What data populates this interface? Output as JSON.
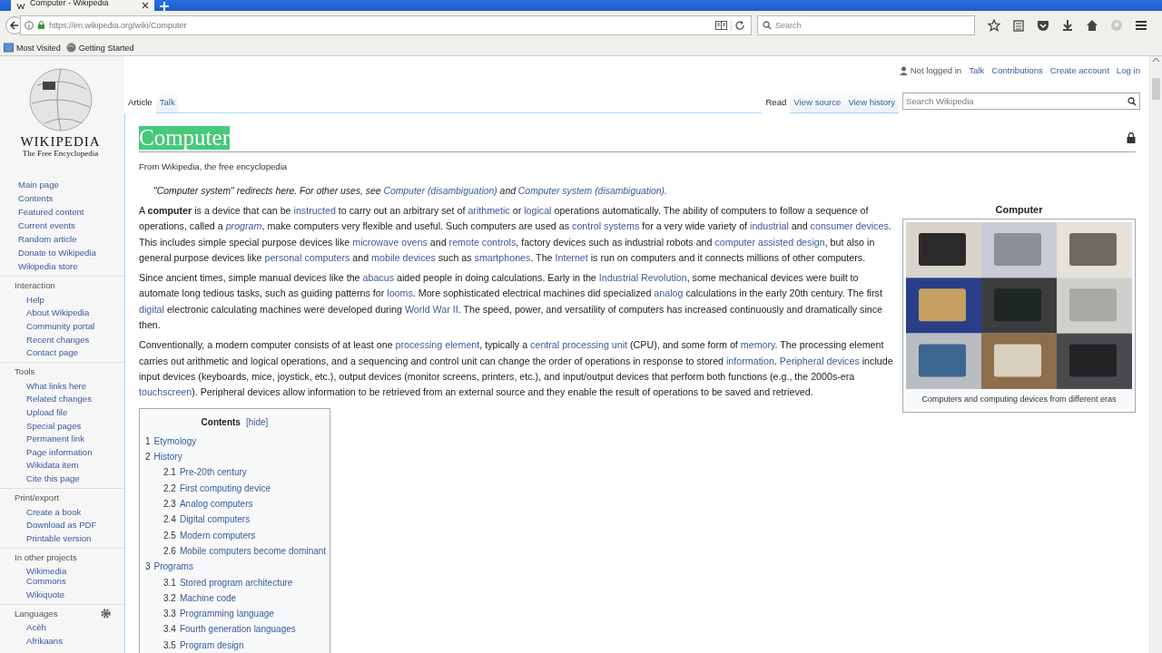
{
  "browser": {
    "tab": {
      "title": "Computer - Wikipedia",
      "selected": true
    },
    "url": "https://en.wikipedia.org/wiki/Computer",
    "search_placeholder": "Search",
    "bookmarks": [
      "Most Visited",
      "Getting Started"
    ]
  },
  "logo": {
    "wordmark": "WIKIPEDIA",
    "tagline": "The Free Encyclopedia"
  },
  "sidebar": {
    "main": [
      "Main page",
      "Contents",
      "Featured content",
      "Current events",
      "Random article",
      "Donate to Wikipedia",
      "Wikipedia store"
    ],
    "sections": [
      {
        "heading": "Interaction",
        "items": [
          "Help",
          "About Wikipedia",
          "Community portal",
          "Recent changes",
          "Contact page"
        ]
      },
      {
        "heading": "Tools",
        "items": [
          "What links here",
          "Related changes",
          "Upload file",
          "Special pages",
          "Permanent link",
          "Page information",
          "Wikidata item",
          "Cite this page"
        ]
      },
      {
        "heading": "Print/export",
        "items": [
          "Create a book",
          "Download as PDF",
          "Printable version"
        ]
      },
      {
        "heading": "In other projects",
        "items": [
          "Wikimedia Commons",
          "Wikiquote"
        ]
      },
      {
        "heading": "Languages",
        "settings": true,
        "items": [
          "Acèh",
          "Afrikaans"
        ]
      }
    ]
  },
  "personal": {
    "status": "Not logged in",
    "links": [
      "Talk",
      "Contributions",
      "Create account",
      "Log in"
    ]
  },
  "left_tabs": [
    {
      "label": "Article",
      "selected": true
    },
    {
      "label": "Talk",
      "selected": false
    }
  ],
  "right_tabs": [
    {
      "label": "Read",
      "selected": true
    },
    {
      "label": "View source",
      "selected": false
    },
    {
      "label": "View history",
      "selected": false
    }
  ],
  "wiki_search": {
    "placeholder": "Search Wikipedia"
  },
  "title": {
    "text": "Computer",
    "highlighted": true
  },
  "tagline": "From Wikipedia, the free encyclopedia",
  "hatnote": [
    {
      "kind": "text",
      "text": "\"Computer system\" redirects here. For other uses, see "
    },
    {
      "kind": "link",
      "text": "Computer (disambiguation)"
    },
    {
      "kind": "text",
      "text": " and "
    },
    {
      "kind": "link",
      "text": "Computer system (disambiguation)"
    },
    {
      "kind": "text",
      "text": "."
    }
  ],
  "paragraphs": [
    [
      {
        "kind": "text",
        "text": "A **computer** is a device that can be "
      },
      {
        "kind": "link",
        "text": "instructed"
      },
      {
        "kind": "text",
        "text": " to carry out an arbitrary set of "
      },
      {
        "kind": "link",
        "text": "arithmetic"
      },
      {
        "kind": "text",
        "text": " or "
      },
      {
        "kind": "link",
        "text": "logical"
      },
      {
        "kind": "text",
        "text": " operations automatically. The ability of computers to follow a sequence of operations, called a "
      },
      {
        "kind": "link",
        "text": "*program*"
      },
      {
        "kind": "text",
        "text": ", make computers very flexible and useful. Such computers are used as "
      },
      {
        "kind": "link",
        "text": "control systems"
      },
      {
        "kind": "text",
        "text": " for a very wide variety of "
      },
      {
        "kind": "link",
        "text": "industrial"
      },
      {
        "kind": "text",
        "text": " and "
      },
      {
        "kind": "link",
        "text": "consumer devices"
      },
      {
        "kind": "text",
        "text": ". This includes simple special purpose devices like "
      },
      {
        "kind": "link",
        "text": "microwave ovens"
      },
      {
        "kind": "text",
        "text": " and "
      },
      {
        "kind": "link",
        "text": "remote controls"
      },
      {
        "kind": "text",
        "text": ", factory devices such as industrial robots and "
      },
      {
        "kind": "link",
        "text": "computer assisted design"
      },
      {
        "kind": "text",
        "text": ", but also in general purpose devices like "
      },
      {
        "kind": "link",
        "text": "personal computers"
      },
      {
        "kind": "text",
        "text": " and "
      },
      {
        "kind": "link",
        "text": "mobile devices"
      },
      {
        "kind": "text",
        "text": " such as "
      },
      {
        "kind": "link",
        "text": "smartphones"
      },
      {
        "kind": "text",
        "text": ". The "
      },
      {
        "kind": "link",
        "text": "Internet"
      },
      {
        "kind": "text",
        "text": " is run on computers and it connects millions of other computers."
      }
    ],
    [
      {
        "kind": "text",
        "text": "Since ancient times, simple manual devices like the "
      },
      {
        "kind": "link",
        "text": "abacus"
      },
      {
        "kind": "text",
        "text": " aided people in doing calculations. Early in the "
      },
      {
        "kind": "link",
        "text": "Industrial Revolution"
      },
      {
        "kind": "text",
        "text": ", some mechanical devices were built to automate long tedious tasks, such as guiding patterns for "
      },
      {
        "kind": "link",
        "text": "looms"
      },
      {
        "kind": "text",
        "text": ". More sophisticated electrical machines did specialized "
      },
      {
        "kind": "link",
        "text": "analog"
      },
      {
        "kind": "text",
        "text": " calculations in the early 20th century. The first "
      },
      {
        "kind": "link",
        "text": "digital"
      },
      {
        "kind": "text",
        "text": " electronic calculating machines were developed during "
      },
      {
        "kind": "link",
        "text": "World War II"
      },
      {
        "kind": "text",
        "text": ". The speed, power, and versatility of computers has increased continuously and dramatically since then."
      }
    ],
    [
      {
        "kind": "text",
        "text": "Conventionally, a modern computer consists of at least one "
      },
      {
        "kind": "link",
        "text": "processing element"
      },
      {
        "kind": "text",
        "text": ", typically a "
      },
      {
        "kind": "link",
        "text": "central processing unit"
      },
      {
        "kind": "text",
        "text": " (CPU), and some form of "
      },
      {
        "kind": "link",
        "text": "memory"
      },
      {
        "kind": "text",
        "text": ". The processing element carries out arithmetic and logical operations, and a sequencing and control unit can change the order of operations in response to stored "
      },
      {
        "kind": "link",
        "text": "information"
      },
      {
        "kind": "text",
        "text": ". "
      },
      {
        "kind": "link",
        "text": "Peripheral devices"
      },
      {
        "kind": "text",
        "text": " include input devices (keyboards, mice, joystick, etc.), output devices (monitor screens, printers, etc.), and input/output devices that perform both functions (e.g., the 2000s-era "
      },
      {
        "kind": "link",
        "text": "touchscreen"
      },
      {
        "kind": "text",
        "text": "). Peripheral devices allow information to be retrieved from an external source and they enable the result of operations to be saved and retrieved."
      }
    ]
  ],
  "toc": {
    "title": "Contents",
    "toggle": "[hide]",
    "items": [
      {
        "number": "1",
        "label": "Etymology"
      },
      {
        "number": "2",
        "label": "History",
        "children": [
          {
            "number": "2.1",
            "label": "Pre-20th century"
          },
          {
            "number": "2.2",
            "label": "First computing device"
          },
          {
            "number": "2.3",
            "label": "Analog computers"
          },
          {
            "number": "2.4",
            "label": "Digital computers"
          },
          {
            "number": "2.5",
            "label": "Modern computers"
          },
          {
            "number": "2.6",
            "label": "Mobile computers become dominant"
          }
        ]
      },
      {
        "number": "3",
        "label": "Programs",
        "children": [
          {
            "number": "3.1",
            "label": "Stored program architecture"
          },
          {
            "number": "3.2",
            "label": "Machine code"
          },
          {
            "number": "3.3",
            "label": "Programming language"
          },
          {
            "number": "3.4",
            "label": "Fourth generation languages"
          },
          {
            "number": "3.5",
            "label": "Program design"
          }
        ]
      }
    ]
  },
  "infobox": {
    "title": "Computer",
    "caption": "Computers and computing devices from different eras"
  }
}
